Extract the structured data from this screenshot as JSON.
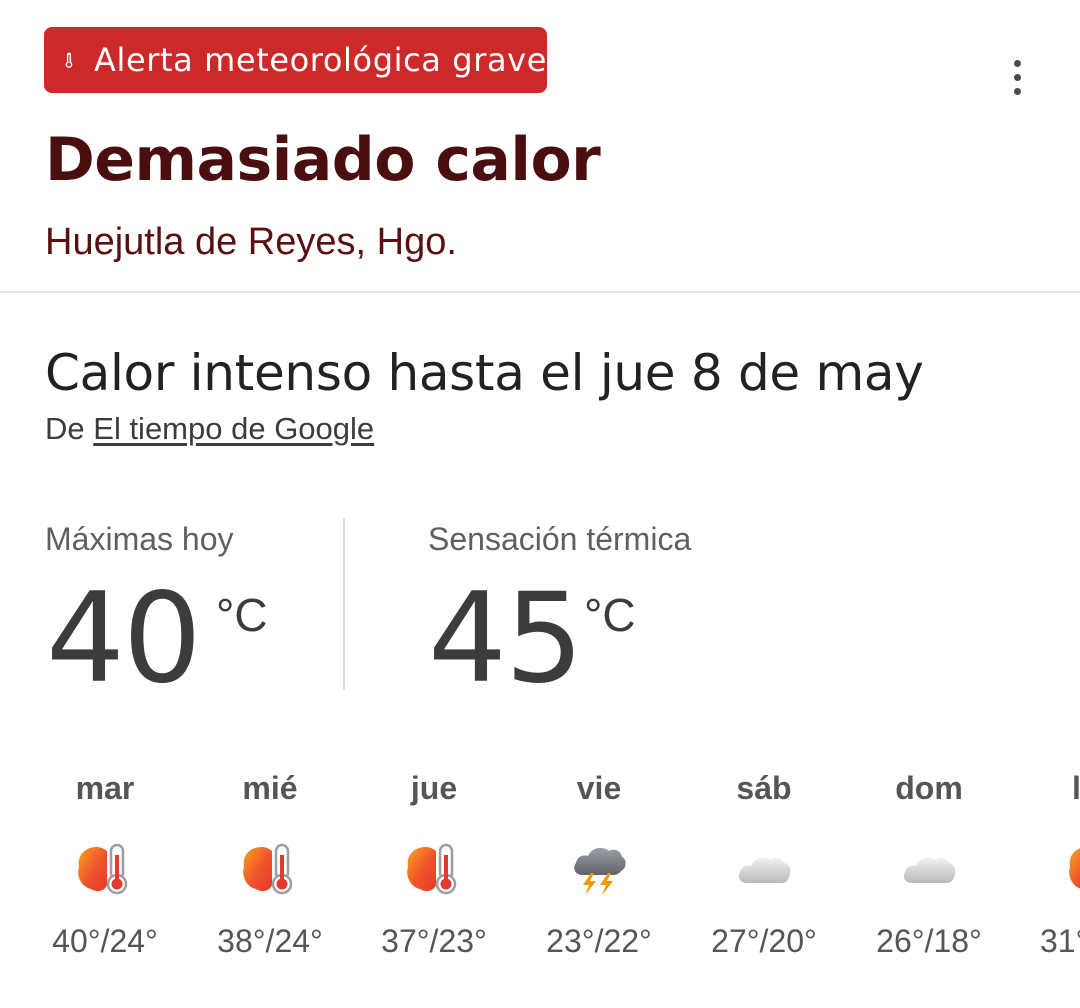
{
  "alert": {
    "badge_label": "Alerta meteorológica grave",
    "badge_icon": "thermometer-icon",
    "badge_color": "#cc2a2a",
    "title": "Demasiado calor",
    "location": "Huejutla de Reyes, Hgo."
  },
  "details": {
    "headline": "Calor intenso hasta el jue 8 de may",
    "source_prefix": "De",
    "source_link": "El tiempo de Google"
  },
  "stats": [
    {
      "label": "Máximas hoy",
      "value": "40",
      "unit": "°C"
    },
    {
      "label": "Sensación térmica",
      "value": "45",
      "unit": "°C"
    }
  ],
  "forecast": [
    {
      "day": "mar",
      "icon": "heat-warning-icon",
      "temps": "40°/24°"
    },
    {
      "day": "mié",
      "icon": "heat-warning-icon",
      "temps": "38°/24°"
    },
    {
      "day": "jue",
      "icon": "heat-warning-icon",
      "temps": "37°/23°"
    },
    {
      "day": "vie",
      "icon": "thunderstorm-icon",
      "temps": "23°/22°"
    },
    {
      "day": "sáb",
      "icon": "cloud-icon",
      "temps": "27°/20°"
    },
    {
      "day": "dom",
      "icon": "cloud-icon",
      "temps": "26°/18°"
    },
    {
      "day": "l",
      "icon": "heat-warning-icon",
      "temps": "31°"
    }
  ],
  "colors": {
    "title": "#4a0e0e",
    "heat_icon": "#f0522a",
    "text": "#3c3c3c"
  }
}
